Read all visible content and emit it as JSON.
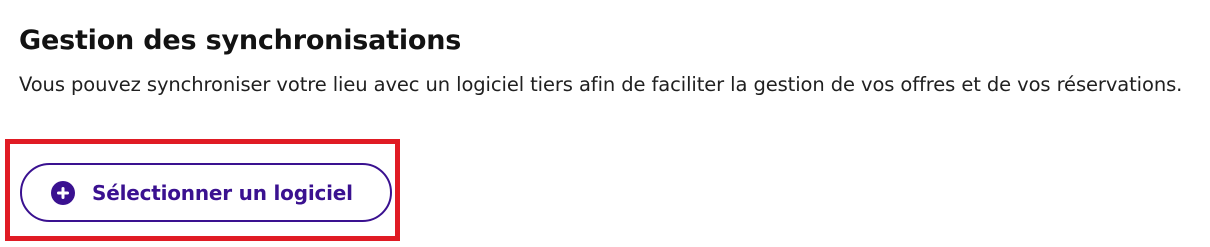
{
  "section": {
    "title": "Gestion des synchronisations",
    "description": "Vous pouvez synchroniser votre lieu avec un logiciel tiers afin de faciliter la gestion de vos offres et de vos réservations."
  },
  "action": {
    "button_label": "Sélectionner un logiciel",
    "icon": "plus-circle-icon"
  },
  "colors": {
    "text": "#151515",
    "accent": "#3a1190",
    "highlight_border": "#e01b24"
  }
}
